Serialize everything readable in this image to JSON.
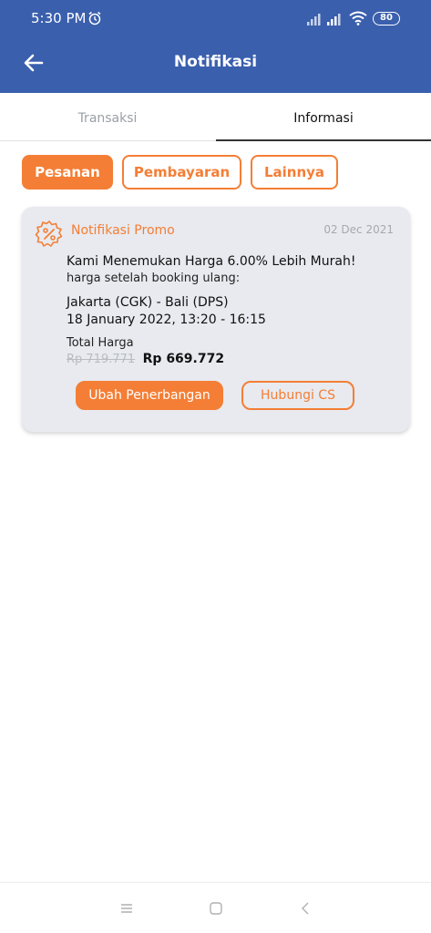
{
  "status_bar": {
    "time": "5:30 PM",
    "battery": "80"
  },
  "header": {
    "title": "Notifikasi"
  },
  "tabs": [
    {
      "label": "Transaksi",
      "active": false
    },
    {
      "label": "Informasi",
      "active": true
    }
  ],
  "filters": [
    {
      "label": "Pesanan",
      "active": true
    },
    {
      "label": "Pembayaran",
      "active": false
    },
    {
      "label": "Lainnya",
      "active": false
    }
  ],
  "notification": {
    "type_label": "Notifikasi Promo",
    "date": "02 Dec 2021",
    "headline": "Kami Menemukan Harga 6.00% Lebih Murah!",
    "subline": "harga setelah booking ulang:",
    "route": "Jakarta (CGK) - Bali (DPS)",
    "schedule": "18 January 2022, 13:20 - 16:15",
    "total_label": "Total Harga",
    "old_price": "Rp 719.771",
    "new_price": "Rp 669.772",
    "primary_button": "Ubah Penerbangan",
    "secondary_button": "Hubungi CS"
  },
  "colors": {
    "brand_blue": "#3A5FAD",
    "accent_orange": "#F47E35",
    "card_bg": "#E8EAEF"
  },
  "icons": [
    "alarm-icon",
    "signal-icon",
    "wifi-icon",
    "battery-icon",
    "back-arrow-icon",
    "promo-percent-icon",
    "menu-icon",
    "home-icon",
    "nav-back-icon"
  ]
}
